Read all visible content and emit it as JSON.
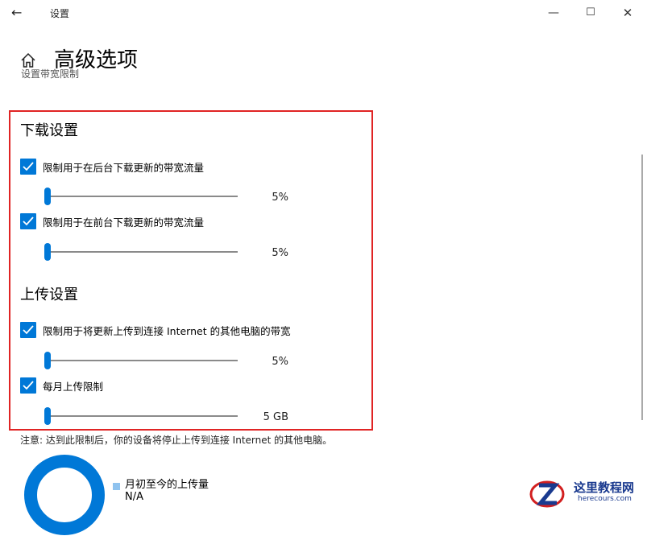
{
  "window": {
    "app_title": "设置",
    "back_glyph": "←",
    "minimize_glyph": "—",
    "maximize_glyph": "☐",
    "close_glyph": "✕"
  },
  "header": {
    "home_icon": "home-icon",
    "page_title": "高级选项",
    "partial_text": "设置带宽限制"
  },
  "download": {
    "title": "下载设置",
    "background": {
      "label": "限制用于在后台下载更新的带宽流量",
      "checked": true,
      "value_label": "5%",
      "value": 5
    },
    "foreground": {
      "label": "限制用于在前台下载更新的带宽流量",
      "checked": true,
      "value_label": "5%",
      "value": 5
    }
  },
  "upload": {
    "title": "上传设置",
    "bandwidth": {
      "label": "限制用于将更新上传到连接 Internet 的其他电脑的带宽",
      "checked": true,
      "value_label": "5%",
      "value": 5
    },
    "monthly": {
      "label": "每月上传限制",
      "checked": true,
      "value_label": "5 GB",
      "value": 5
    }
  },
  "note": "注意: 达到此限制后，你的设备将停止上传到连接 Internet 的其他电脑。",
  "usage": {
    "legend_label": "月初至今的上传量",
    "legend_value": "N/A"
  },
  "colors": {
    "accent": "#0078d7",
    "highlight_border": "#e02424",
    "legend_swatch": "#8fc3ef"
  },
  "watermark": {
    "text": "这里教程网",
    "url": "herecours.com"
  }
}
